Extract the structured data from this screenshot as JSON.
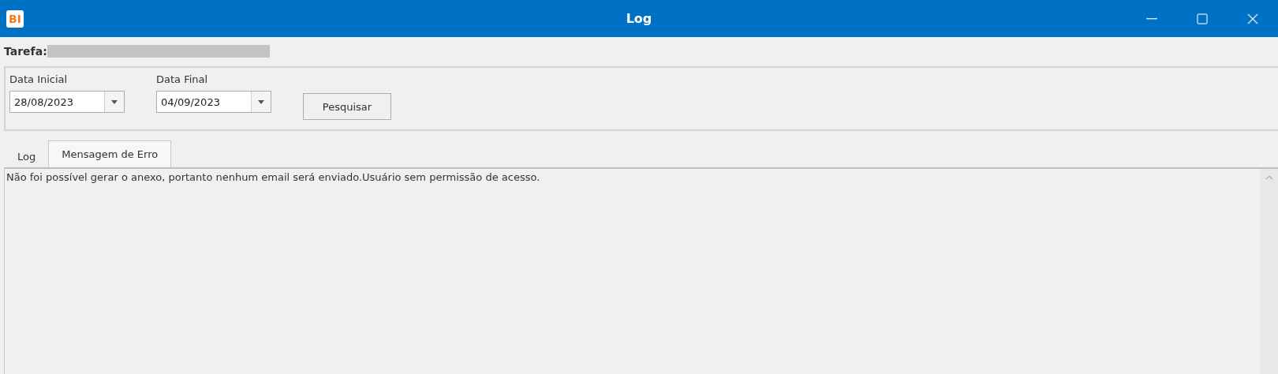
{
  "window": {
    "logo": "BI",
    "title": "Log"
  },
  "task": {
    "label": "Tarefa:",
    "value_redacted": true
  },
  "filters": [
    {
      "label": "Data Inicial",
      "value": "28/08/2023"
    },
    {
      "label": "Data Final",
      "value": "04/09/2023"
    }
  ],
  "search_button": "Pesquisar",
  "tabs": [
    {
      "label": "Log",
      "selected": false
    },
    {
      "label": "Mensagem de Erro",
      "selected": true
    }
  ],
  "message": "Não foi possível gerar o anexo, portanto nenhum email será enviado.Usuário sem permissão de acesso."
}
